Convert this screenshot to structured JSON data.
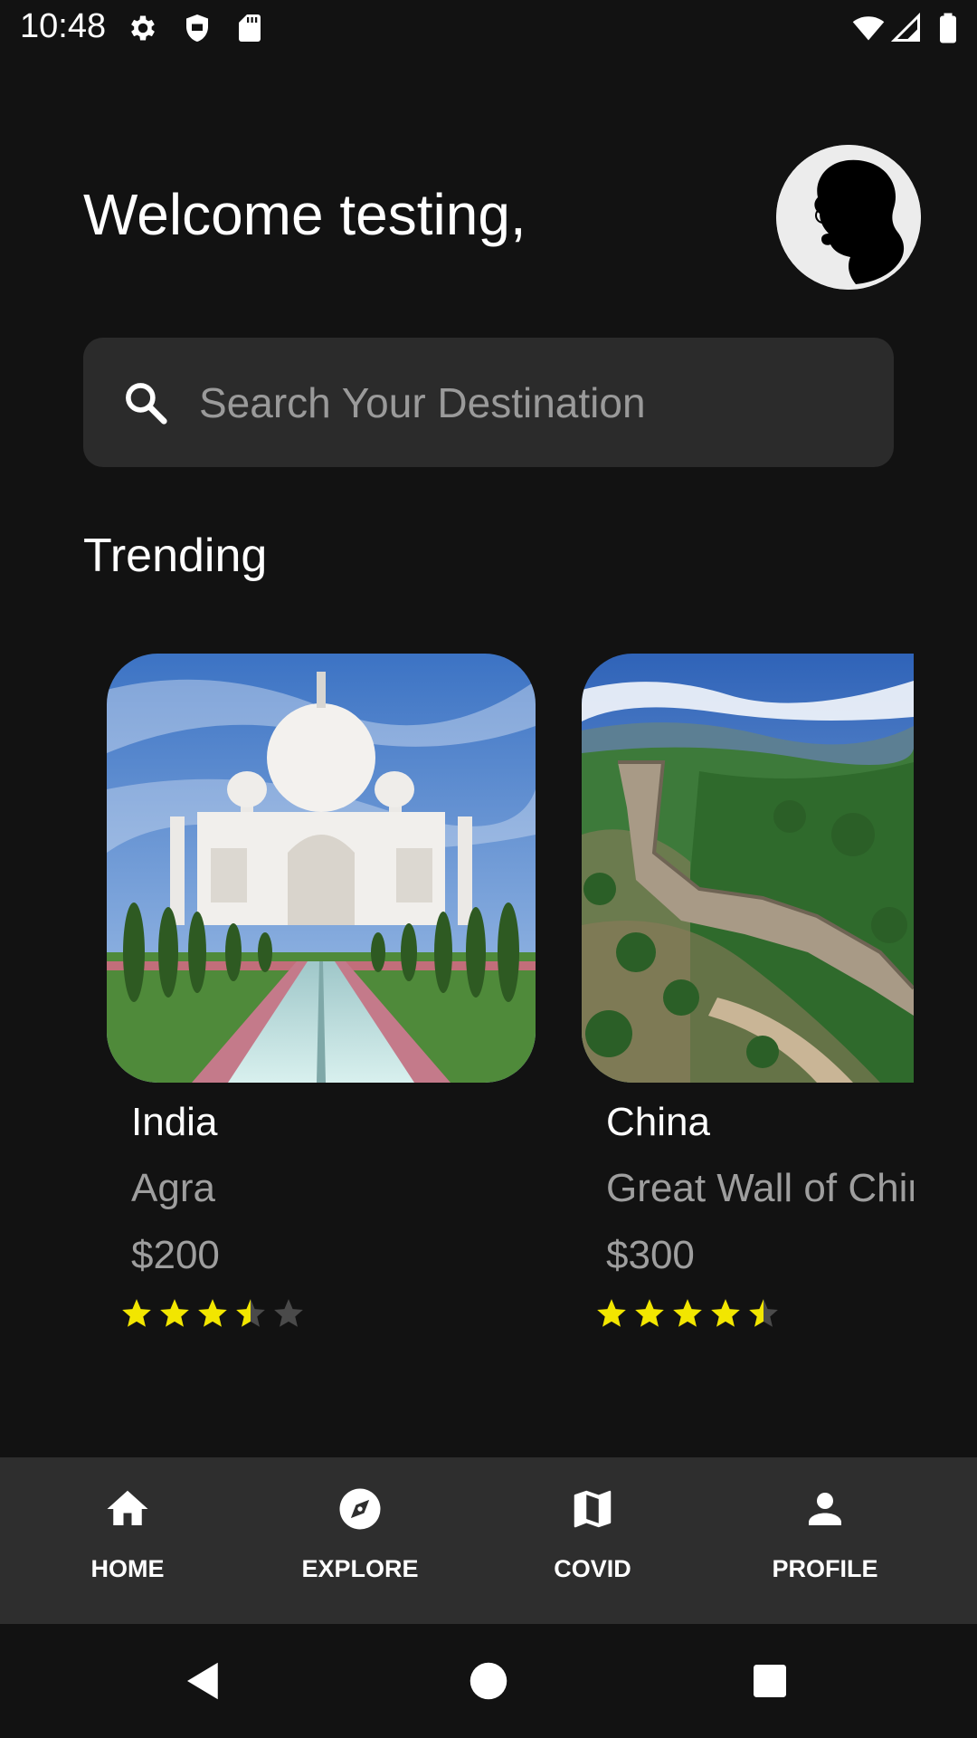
{
  "status_bar": {
    "time": "10:48",
    "icons": [
      "gear-icon",
      "shield-icon",
      "sd-card-icon",
      "wifi-icon",
      "signal-icon",
      "battery-icon"
    ]
  },
  "header": {
    "welcome": "Welcome testing,"
  },
  "search": {
    "placeholder": "Search Your Destination",
    "value": ""
  },
  "trending": {
    "title": "Trending",
    "cards": [
      {
        "country": "India",
        "place": "Agra",
        "price": "$200",
        "rating": 3.5,
        "rating_max": 5
      },
      {
        "country": "China",
        "place": "Great Wall of China",
        "price": "$300",
        "rating": 4.5,
        "rating_max": 5
      }
    ]
  },
  "bottom_nav": {
    "items": [
      {
        "label": "HOME",
        "icon": "home-icon"
      },
      {
        "label": "EXPLORE",
        "icon": "compass-icon"
      },
      {
        "label": "COVID",
        "icon": "map-icon"
      },
      {
        "label": "PROFILE",
        "icon": "person-icon"
      }
    ]
  },
  "colors": {
    "background": "#121212",
    "surface": "#2b2b2b",
    "nav_background": "#2e2e2e",
    "star_filled": "#f2e600",
    "star_empty": "#4a4a4a",
    "secondary_text": "#9e9e9e"
  }
}
